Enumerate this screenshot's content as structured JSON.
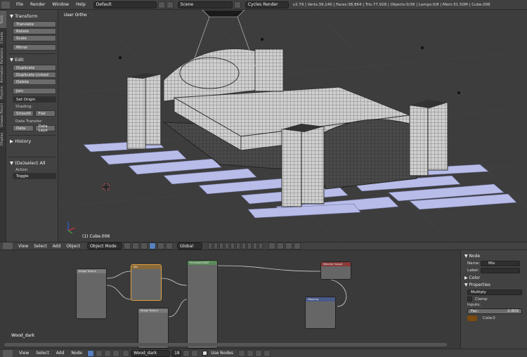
{
  "topbar": {
    "menus": [
      "File",
      "Render",
      "Window",
      "Help"
    ],
    "layout": "Default",
    "scene": "Scene",
    "engine": "Cycles Render",
    "stats": "v2.79 | Verts:39,140 | Faces:38,864 | Tris:77,928 | Objects:0/36 | Lamps:0/8 | Mem:51.50M | Cube.006"
  },
  "side_tabs": [
    "Tools",
    "Create",
    "Relations",
    "Animation",
    "Physics",
    "Grease Pencil",
    "Display"
  ],
  "tool": {
    "transform_title": "Transform",
    "translate": "Translate",
    "rotate": "Rotate",
    "scale": "Scale",
    "mirror": "Mirror",
    "edit_title": "Edit",
    "duplicate": "Duplicate",
    "duplicate_linked": "Duplicate Linked",
    "delete": "Delete",
    "join": "Join",
    "set_origin": "Set Origin",
    "shading_label": "Shading:",
    "smooth": "Smooth",
    "flat": "Flat",
    "data_transfer_label": "Data Transfer:",
    "data": "Data",
    "data_layout": "Data Layo",
    "history_title": "History",
    "deselect_title": "(De)select All",
    "action_label": "Action",
    "action_value": "Toggle"
  },
  "viewport": {
    "view_label": "User Ortho",
    "object_label": "(1) Cube.006"
  },
  "view3d_header": {
    "menus": [
      "View",
      "Select",
      "Add",
      "Object"
    ],
    "mode": "Object Mode",
    "orientation": "Global"
  },
  "node_editor": {
    "material_name": "Wood_dark",
    "nodes": [
      "Image Texture",
      "Mix",
      "Principled BSDF",
      "Material Output",
      "Image Texture",
      "Mapping"
    ]
  },
  "node_panel": {
    "node_title": "Node",
    "name_label": "Name:",
    "name_value": "Mix",
    "label_label": "Label:",
    "label_value": "",
    "color_title": "Color",
    "properties_title": "Properties",
    "blend_mode": "Multiply",
    "clamp": "Clamp",
    "inputs_label": "Inputs:",
    "fac_label": "Fac:",
    "fac_value": "0.809",
    "color2_label": "Color2"
  },
  "bottombar": {
    "menus": [
      "View",
      "Select",
      "Add",
      "Node"
    ],
    "material": "Wood_dark",
    "users": "18",
    "use_nodes": "Use Nodes"
  },
  "colors": {
    "floor_planks": "#b8bce8",
    "wireframe": "#2a2a2a",
    "selected_node": "#e0a040",
    "color2_swatch": "#7a4a10"
  }
}
